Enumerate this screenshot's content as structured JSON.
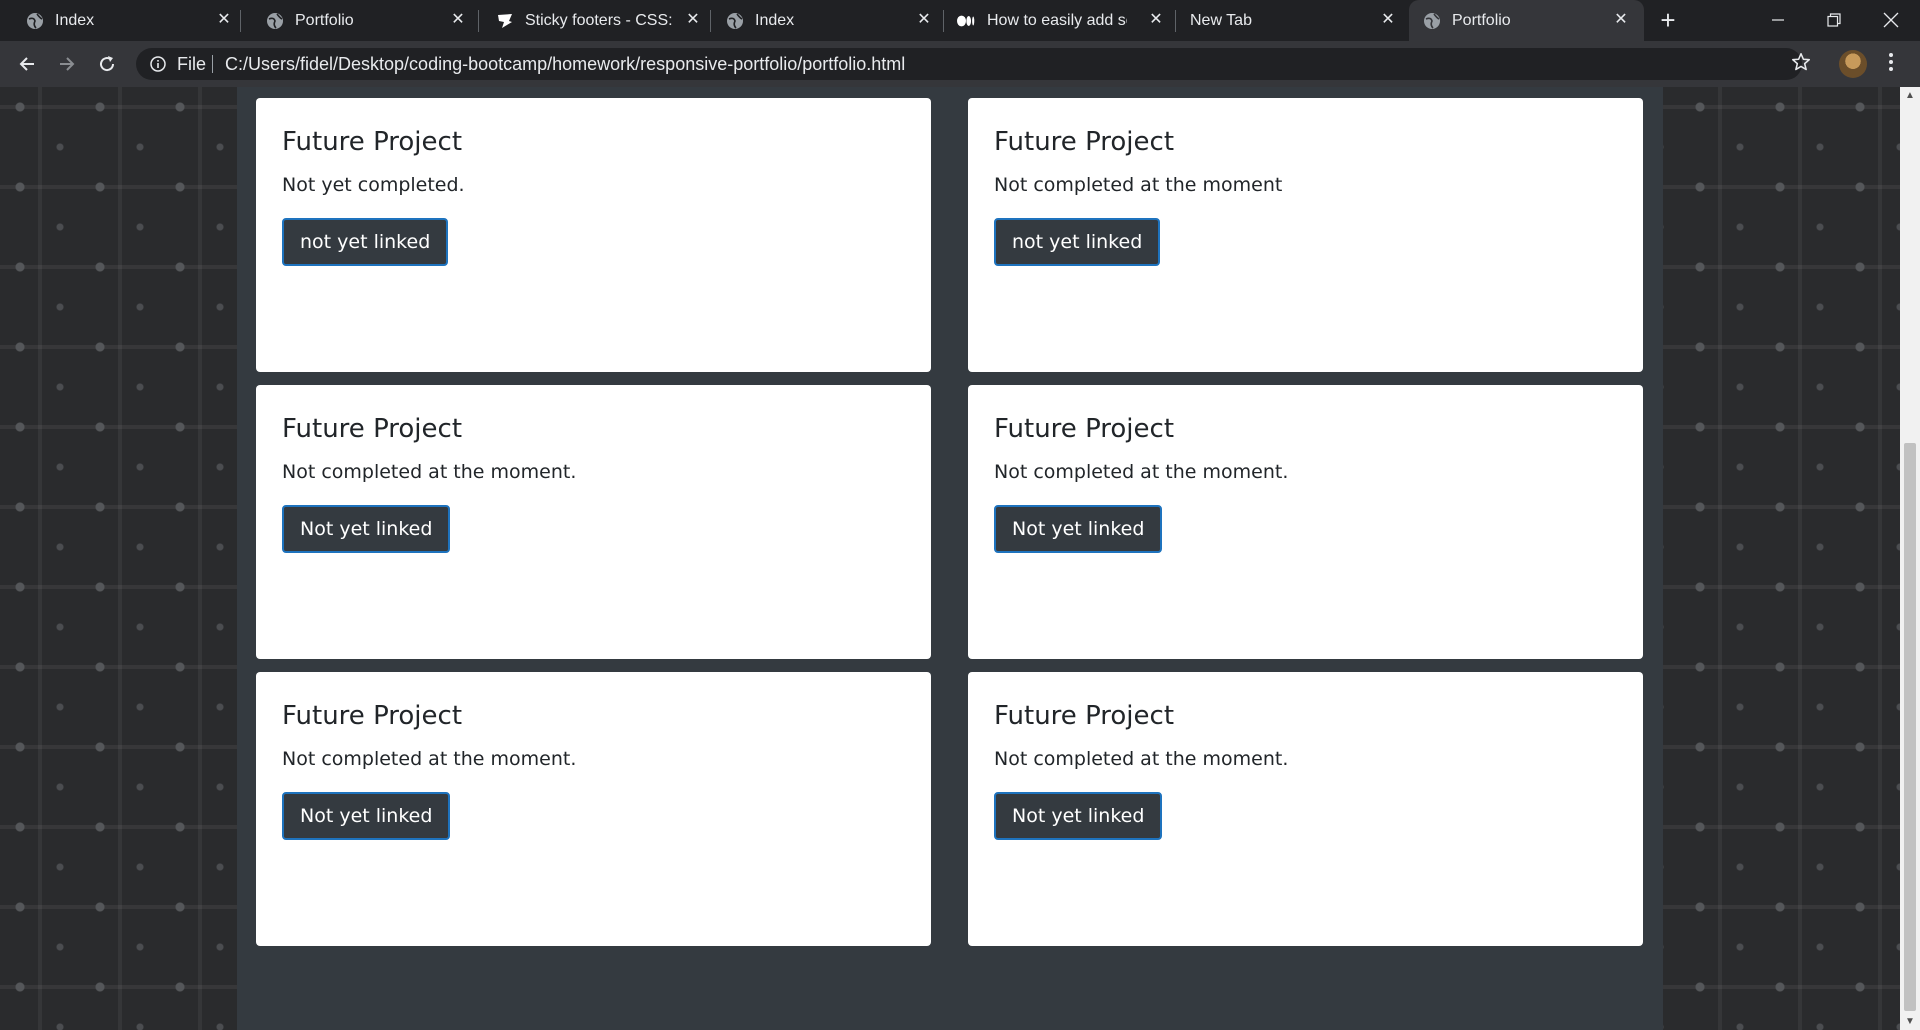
{
  "browser": {
    "tabs": [
      {
        "title": "Index",
        "favicon": "globe-icon",
        "active": false
      },
      {
        "title": "Portfolio",
        "favicon": "globe-icon",
        "active": false
      },
      {
        "title": "Sticky footers - CSS: Ca",
        "favicon": "css-tricks-icon",
        "active": false
      },
      {
        "title": "Index",
        "favicon": "globe-icon",
        "active": false
      },
      {
        "title": "How to easily add scre",
        "favicon": "medium-icon",
        "active": false
      },
      {
        "title": "New Tab",
        "favicon": "",
        "active": false
      },
      {
        "title": "Portfolio",
        "favicon": "globe-icon",
        "active": true
      }
    ],
    "new_tab_label": "+",
    "address": {
      "scheme_label": "File",
      "url": "C:/Users/fidel/Desktop/coding-bootcamp/homework/responsive-portfolio/portfolio.html"
    }
  },
  "page": {
    "cards": [
      {
        "title": "Future Project",
        "text": "Not yet completed.",
        "button": "not yet linked"
      },
      {
        "title": "Future Project",
        "text": "Not completed at the moment",
        "button": "not yet linked"
      },
      {
        "title": "Future Project",
        "text": "Not completed at the moment.",
        "button": "Not yet linked"
      },
      {
        "title": "Future Project",
        "text": "Not completed at the moment.",
        "button": "Not yet linked"
      },
      {
        "title": "Future Project",
        "text": "Not completed at the moment.",
        "button": "Not yet linked"
      },
      {
        "title": "Future Project",
        "text": "Not completed at the moment.",
        "button": "Not yet linked"
      }
    ]
  },
  "colors": {
    "chrome_bg": "#202124",
    "toolbar_bg": "#35363a",
    "container_bg": "#343a40",
    "button_bg": "#343a40",
    "button_border": "#1e73be",
    "card_bg": "#ffffff"
  },
  "scrollbar": {
    "position_fraction": 0.6
  }
}
